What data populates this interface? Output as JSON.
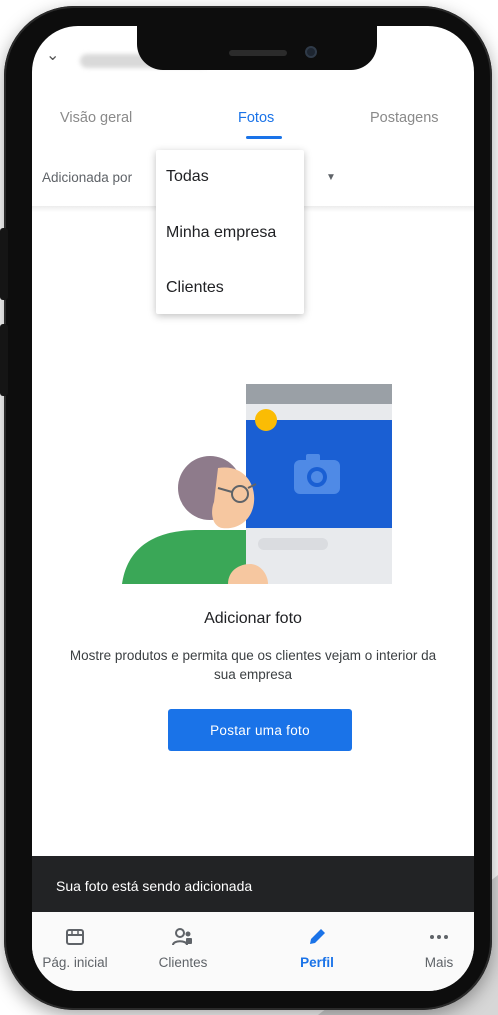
{
  "tabs": [
    "Visão geral",
    "Fotos",
    "Postagens"
  ],
  "filter": {
    "label": "Adicionada por"
  },
  "dropdown": {
    "options": [
      "Todas",
      "Minha empresa",
      "Clientes"
    ]
  },
  "empty_state": {
    "title": "Adicionar foto",
    "description": "Mostre produtos e permita que os clientes vejam o interior da sua empresa",
    "button": "Postar uma foto"
  },
  "snackbar": "Sua foto está sendo adicionada",
  "nav": [
    {
      "label": "Pág. inicial",
      "icon": "storefront-icon"
    },
    {
      "label": "Clientes",
      "icon": "customers-icon"
    },
    {
      "label": "Perfil",
      "icon": "edit-pencil-icon",
      "active": true
    },
    {
      "label": "Mais",
      "icon": "more-dots-icon"
    }
  ],
  "colors": {
    "accent": "#1a73e8",
    "snackbar": "#222325",
    "illustration_blue": "#1a5fd3",
    "avatar_green": "#3aa757"
  }
}
